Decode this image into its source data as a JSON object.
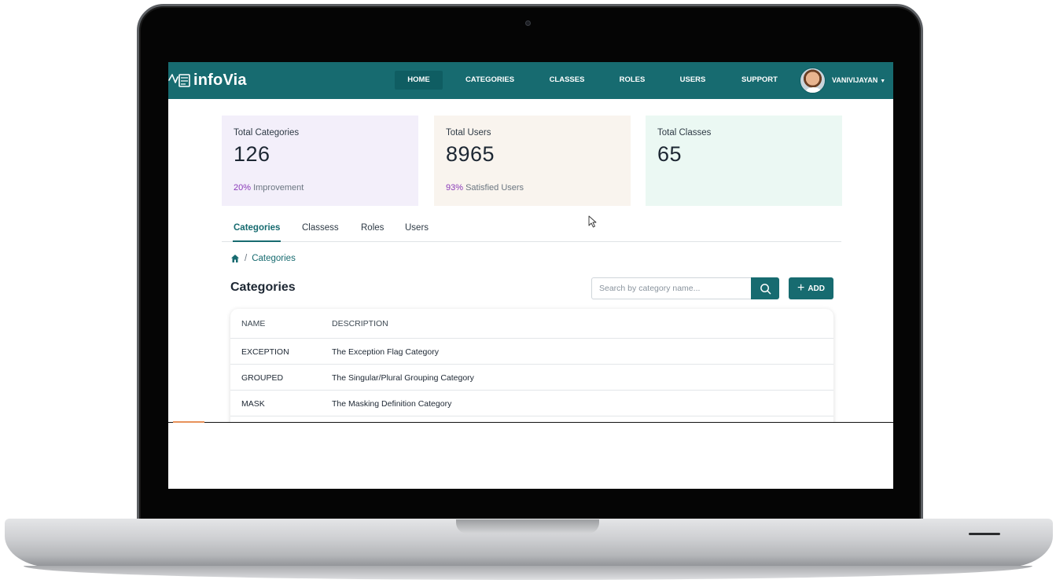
{
  "app": {
    "logo_text": "infoVia"
  },
  "nav": {
    "items": [
      {
        "label": "HOME",
        "active": true
      },
      {
        "label": "CATEGORIES",
        "active": false
      },
      {
        "label": "CLASSES",
        "active": false
      },
      {
        "label": "ROLES",
        "active": false
      },
      {
        "label": "USERS",
        "active": false
      },
      {
        "label": "SUPPORT",
        "active": false
      }
    ],
    "user_name": "VANIVIJAYAN",
    "user_menu_icon": "caret-down-icon"
  },
  "stats": [
    {
      "label": "Total Categories",
      "value": "126",
      "sub_pct": "20%",
      "sub_text": " Improvement",
      "bg": "#f3effa"
    },
    {
      "label": "Total Users",
      "value": "8965",
      "sub_pct": "93%",
      "sub_text": " Satisfied Users",
      "bg": "#f9f4ee"
    },
    {
      "label": "Total Classes",
      "value": "65",
      "sub_pct": "",
      "sub_text": "",
      "bg": "#ebf8f3"
    }
  ],
  "tabs": [
    {
      "label": "Categories",
      "active": true
    },
    {
      "label": "Classess",
      "active": false
    },
    {
      "label": "Roles",
      "active": false
    },
    {
      "label": "Users",
      "active": false
    }
  ],
  "breadcrumb": {
    "home_icon": "home-icon",
    "separator": "/",
    "current": "Categories"
  },
  "page_title": "Categories",
  "search": {
    "placeholder": "Search by category name...",
    "value": "",
    "icon": "search-icon"
  },
  "add_button": {
    "label": "ADD",
    "icon": "plus-icon"
  },
  "table": {
    "columns": [
      "NAME",
      "DESCRIPTION"
    ],
    "rows": [
      {
        "name": "EXCEPTION",
        "description": "The Exception Flag Category"
      },
      {
        "name": "GROUPED",
        "description": "The Singular/Plural Grouping Category"
      },
      {
        "name": "MASK",
        "description": "The Masking Definition Category"
      }
    ]
  },
  "colors": {
    "brand": "#176b70",
    "brand_dark": "#0f5d62",
    "accent_purple": "#8a3ab9"
  }
}
